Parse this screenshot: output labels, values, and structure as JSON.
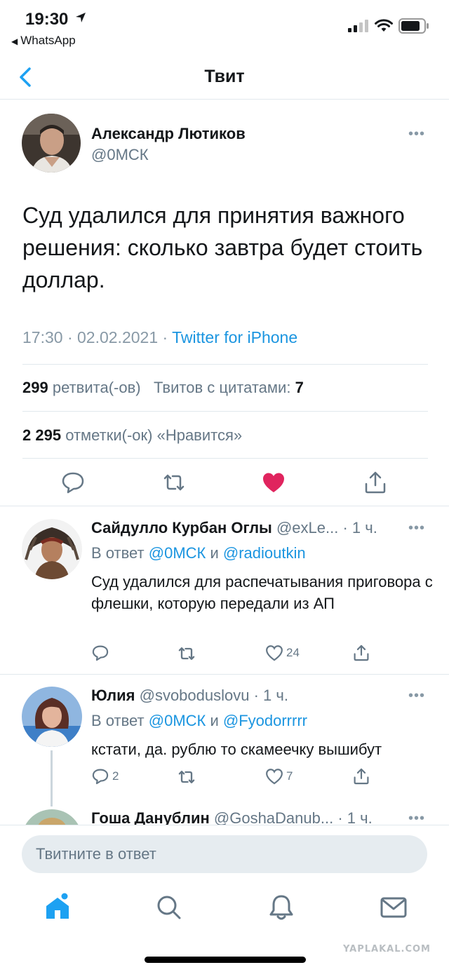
{
  "status_bar": {
    "time": "19:30",
    "back_app": "WhatsApp"
  },
  "nav": {
    "title": "Твит"
  },
  "main_tweet": {
    "author_name": "Александр Лютиков",
    "author_handle": "@0МСК",
    "text": "Суд удалился для принятия важного решения: сколько завтра будет стоить доллар.",
    "time": "17:30 · 02.02.2021 · ",
    "source": "Twitter for iPhone",
    "retweets_count": "299",
    "retweets_label": "ретвита(-ов)",
    "quotes_label": "Твитов с цитатами:",
    "quotes_count": "7",
    "likes_count": "2 295",
    "likes_label": "отметки(-ок) «Нравится»",
    "liked": true,
    "like_color": "#e0245e"
  },
  "replies": [
    {
      "name": "Сайдулло Курбан Оглы",
      "handle": "@exLe...",
      "time": "· 1 ч.",
      "reply_prefix": "В ответ ",
      "mention1": "@0МСК",
      "reply_and": " и ",
      "mention2": "@radioutkin",
      "text": "Суд удалился для распечатывания приговора с флешки, которую передали из АП",
      "replies_count": "",
      "likes_count": "24"
    },
    {
      "name": "Юлия",
      "handle": "@svoboduslovu",
      "time": "· 1 ч.",
      "reply_prefix": "В ответ ",
      "mention1": "@0МСК",
      "reply_and": " и ",
      "mention2": "@Fyodorrrrr",
      "text": "кстати, да. рублю то скамеечку вышибут",
      "replies_count": "2",
      "likes_count": "7"
    },
    {
      "name": "Гоша Данублин",
      "handle": "@GoshaDanub...",
      "time": "· 1 ч."
    }
  ],
  "compose": {
    "placeholder": "Твитните в ответ"
  },
  "tabs": [
    "home-icon",
    "search-icon",
    "bell-icon",
    "mail-icon"
  ],
  "accent_color": "#1da1f2",
  "watermark": "YAPLAKAL.COM"
}
